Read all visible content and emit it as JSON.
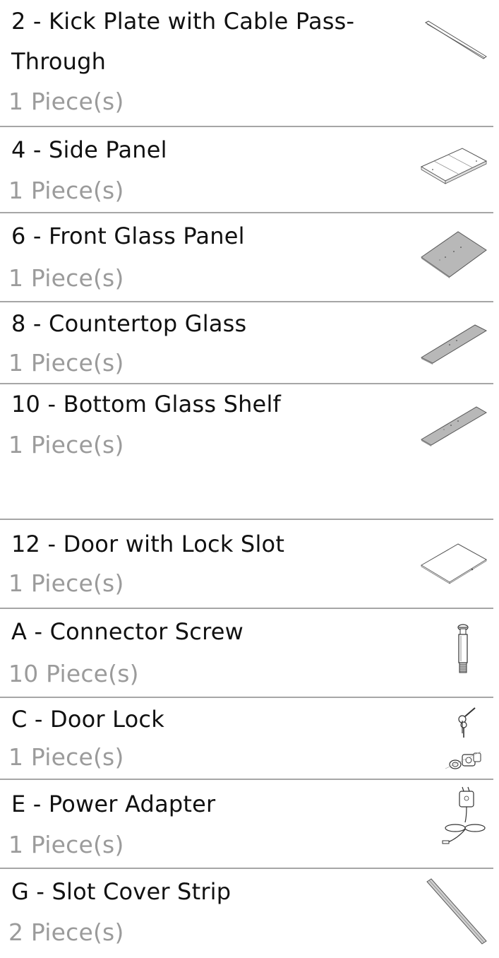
{
  "parts": [
    {
      "id": "2",
      "name": "2 - Kick Plate with Cable Pass-Through",
      "quantity": "1 Piece(s)",
      "icon": "kick-plate-icon"
    },
    {
      "id": "4",
      "name": "4 - Side Panel",
      "quantity": "1 Piece(s)",
      "icon": "side-panel-icon"
    },
    {
      "id": "6",
      "name": "6 - Front Glass Panel",
      "quantity": "1 Piece(s)",
      "icon": "front-glass-panel-icon"
    },
    {
      "id": "8",
      "name": "8 - Countertop Glass",
      "quantity": "1 Piece(s)",
      "icon": "countertop-glass-icon"
    },
    {
      "id": "10",
      "name": "10 - Bottom Glass Shelf",
      "quantity": "1 Piece(s)",
      "icon": "bottom-glass-shelf-icon"
    },
    {
      "id": "12",
      "name": "12 - Door with Lock Slot",
      "quantity": "1 Piece(s)",
      "icon": "door-icon"
    },
    {
      "id": "A",
      "name": "A - Connector Screw",
      "quantity": "10 Piece(s)",
      "icon": "connector-screw-icon"
    },
    {
      "id": "C",
      "name": "C - Door Lock",
      "quantity": "1 Piece(s)",
      "icon": "door-lock-icon"
    },
    {
      "id": "E",
      "name": "E - Power Adapter",
      "quantity": "1 Piece(s)",
      "icon": "power-adapter-icon"
    },
    {
      "id": "G",
      "name": "G - Slot Cover Strip",
      "quantity": "2 Piece(s)",
      "icon": "slot-cover-strip-icon"
    }
  ],
  "colors": {
    "text": "#111111",
    "quantity_text": "#9b9b9b",
    "divider": "#a6a6a6",
    "drawing_stroke": "#555555",
    "glass_fill": "#b8b8b8"
  }
}
